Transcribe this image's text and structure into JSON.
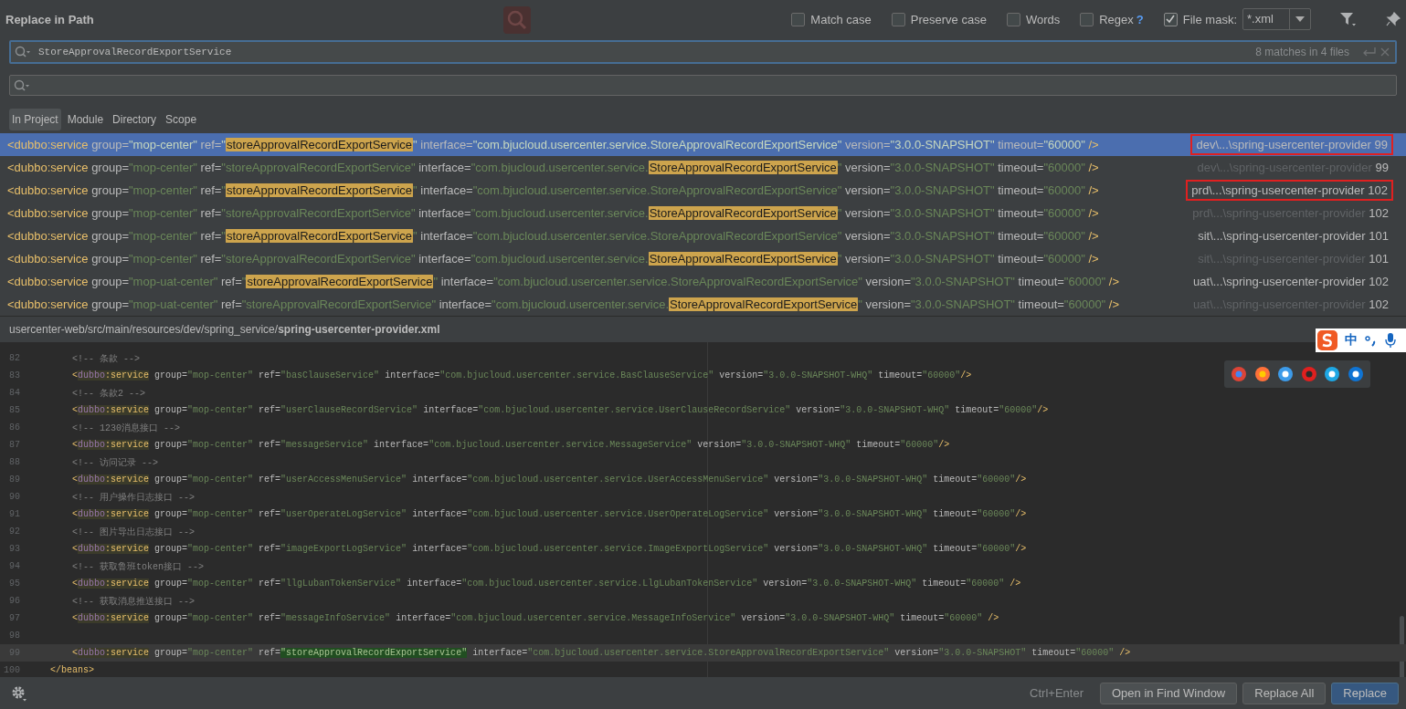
{
  "dialog": {
    "title": "Replace in Path"
  },
  "options": [
    {
      "label": "Match case",
      "checked": false
    },
    {
      "label": "Preserve case",
      "checked": false
    },
    {
      "label": "Words",
      "checked": false
    },
    {
      "label": "Regex",
      "checked": false,
      "help": "?"
    },
    {
      "label": "File mask:",
      "checked": true
    }
  ],
  "file_mask": {
    "value": "*.xml"
  },
  "search": {
    "value": "StoreApprovalRecordExportService",
    "match_count": "8 matches in 4 files"
  },
  "scopes": [
    {
      "label": "In Project",
      "selected": true
    },
    {
      "label": "Module",
      "selected": false
    },
    {
      "label": "Directory",
      "selected": false
    },
    {
      "label": "Scope",
      "selected": false
    }
  ],
  "results": [
    {
      "selected": true,
      "boxed": true,
      "muted_path": false,
      "path": "dev\\...\\spring-usercenter-provider",
      "line": "99",
      "tokens": [
        {
          "kind": "tag",
          "text": "<dubbo:service"
        },
        {
          "kind": "attr",
          "text": " group="
        },
        {
          "kind": "str",
          "text": "\"mop-center\""
        },
        {
          "kind": "attr",
          "text": " ref="
        },
        {
          "kind": "str",
          "text": "\""
        },
        {
          "kind": "match",
          "text": "storeApprovalRecordExportService"
        },
        {
          "kind": "str",
          "text": "\""
        },
        {
          "kind": "attr",
          "text": " interface="
        },
        {
          "kind": "str",
          "text": "\"com.bjucloud.usercenter.service.StoreApprovalRecordExportService\""
        },
        {
          "kind": "attr",
          "text": " version="
        },
        {
          "kind": "str",
          "text": "\"3.0.0-SNAPSHOT\""
        },
        {
          "kind": "attr",
          "text": " timeout="
        },
        {
          "kind": "str",
          "text": "\"60000\""
        },
        {
          "kind": "tag",
          "text": " />"
        }
      ]
    },
    {
      "selected": false,
      "boxed": false,
      "muted_path": true,
      "path": "dev\\...\\spring-usercenter-provider",
      "line": "99",
      "tokens": [
        {
          "kind": "tag",
          "text": "<dubbo:service"
        },
        {
          "kind": "attr",
          "text": " group="
        },
        {
          "kind": "str",
          "text": "\"mop-center\""
        },
        {
          "kind": "attr",
          "text": " ref="
        },
        {
          "kind": "str",
          "text": "\"storeApprovalRecordExportService\""
        },
        {
          "kind": "attr",
          "text": " interface="
        },
        {
          "kind": "str",
          "text": "\"com.bjucloud.usercenter.service."
        },
        {
          "kind": "match",
          "text": "StoreApprovalRecordExportService"
        },
        {
          "kind": "str",
          "text": "\""
        },
        {
          "kind": "attr",
          "text": " version="
        },
        {
          "kind": "str",
          "text": "\"3.0.0-SNAPSHOT\""
        },
        {
          "kind": "attr",
          "text": " timeout="
        },
        {
          "kind": "str",
          "text": "\"60000\""
        },
        {
          "kind": "tag",
          "text": " />"
        }
      ]
    },
    {
      "selected": false,
      "boxed": true,
      "muted_path": false,
      "path": "prd\\...\\spring-usercenter-provider",
      "line": "102",
      "tokens": [
        {
          "kind": "tag",
          "text": "<dubbo:service"
        },
        {
          "kind": "attr",
          "text": " group="
        },
        {
          "kind": "str",
          "text": "\"mop-center\""
        },
        {
          "kind": "attr",
          "text": " ref="
        },
        {
          "kind": "str",
          "text": "\""
        },
        {
          "kind": "match",
          "text": "storeApprovalRecordExportService"
        },
        {
          "kind": "str",
          "text": "\""
        },
        {
          "kind": "attr",
          "text": " interface="
        },
        {
          "kind": "str",
          "text": "\"com.bjucloud.usercenter.service.StoreApprovalRecordExportService\""
        },
        {
          "kind": "attr",
          "text": " version="
        },
        {
          "kind": "str",
          "text": "\"3.0.0-SNAPSHOT\""
        },
        {
          "kind": "attr",
          "text": " timeout="
        },
        {
          "kind": "str",
          "text": "\"60000\""
        },
        {
          "kind": "tag",
          "text": " />"
        }
      ]
    },
    {
      "selected": false,
      "boxed": false,
      "muted_path": true,
      "path": "prd\\...\\spring-usercenter-provider",
      "line": "102",
      "tokens": [
        {
          "kind": "tag",
          "text": "<dubbo:service"
        },
        {
          "kind": "attr",
          "text": " group="
        },
        {
          "kind": "str",
          "text": "\"mop-center\""
        },
        {
          "kind": "attr",
          "text": " ref="
        },
        {
          "kind": "str",
          "text": "\"storeApprovalRecordExportService\""
        },
        {
          "kind": "attr",
          "text": " interface="
        },
        {
          "kind": "str",
          "text": "\"com.bjucloud.usercenter.service."
        },
        {
          "kind": "match",
          "text": "StoreApprovalRecordExportService"
        },
        {
          "kind": "str",
          "text": "\""
        },
        {
          "kind": "attr",
          "text": " version="
        },
        {
          "kind": "str",
          "text": "\"3.0.0-SNAPSHOT\""
        },
        {
          "kind": "attr",
          "text": " timeout="
        },
        {
          "kind": "str",
          "text": "\"60000\""
        },
        {
          "kind": "tag",
          "text": " />"
        }
      ]
    },
    {
      "selected": false,
      "boxed": false,
      "muted_path": false,
      "path": "sit\\...\\spring-usercenter-provider",
      "line": "101",
      "tokens": [
        {
          "kind": "tag",
          "text": "<dubbo:service"
        },
        {
          "kind": "attr",
          "text": " group="
        },
        {
          "kind": "str",
          "text": "\"mop-center\""
        },
        {
          "kind": "attr",
          "text": " ref="
        },
        {
          "kind": "str",
          "text": "\""
        },
        {
          "kind": "match",
          "text": "storeApprovalRecordExportService"
        },
        {
          "kind": "str",
          "text": "\""
        },
        {
          "kind": "attr",
          "text": " interface="
        },
        {
          "kind": "str",
          "text": "\"com.bjucloud.usercenter.service.StoreApprovalRecordExportService\""
        },
        {
          "kind": "attr",
          "text": " version="
        },
        {
          "kind": "str",
          "text": "\"3.0.0-SNAPSHOT\""
        },
        {
          "kind": "attr",
          "text": " timeout="
        },
        {
          "kind": "str",
          "text": "\"60000\""
        },
        {
          "kind": "tag",
          "text": " />"
        }
      ]
    },
    {
      "selected": false,
      "boxed": false,
      "muted_path": true,
      "path": "sit\\...\\spring-usercenter-provider",
      "line": "101",
      "tokens": [
        {
          "kind": "tag",
          "text": "<dubbo:service"
        },
        {
          "kind": "attr",
          "text": " group="
        },
        {
          "kind": "str",
          "text": "\"mop-center\""
        },
        {
          "kind": "attr",
          "text": " ref="
        },
        {
          "kind": "str",
          "text": "\"storeApprovalRecordExportService\""
        },
        {
          "kind": "attr",
          "text": " interface="
        },
        {
          "kind": "str",
          "text": "\"com.bjucloud.usercenter.service."
        },
        {
          "kind": "match",
          "text": "StoreApprovalRecordExportService"
        },
        {
          "kind": "str",
          "text": "\""
        },
        {
          "kind": "attr",
          "text": " version="
        },
        {
          "kind": "str",
          "text": "\"3.0.0-SNAPSHOT\""
        },
        {
          "kind": "attr",
          "text": " timeout="
        },
        {
          "kind": "str",
          "text": "\"60000\""
        },
        {
          "kind": "tag",
          "text": " />"
        }
      ]
    },
    {
      "selected": false,
      "boxed": false,
      "muted_path": false,
      "path": "uat\\...\\spring-usercenter-provider",
      "line": "102",
      "tokens": [
        {
          "kind": "tag",
          "text": "<dubbo:service"
        },
        {
          "kind": "attr",
          "text": " group="
        },
        {
          "kind": "str",
          "text": "\"mop-uat-center\""
        },
        {
          "kind": "attr",
          "text": " ref="
        },
        {
          "kind": "str",
          "text": "\""
        },
        {
          "kind": "match",
          "text": "storeApprovalRecordExportService"
        },
        {
          "kind": "str",
          "text": "\""
        },
        {
          "kind": "attr",
          "text": " interface="
        },
        {
          "kind": "str",
          "text": "\"com.bjucloud.usercenter.service.StoreApprovalRecordExportService\""
        },
        {
          "kind": "attr",
          "text": " version="
        },
        {
          "kind": "str",
          "text": "\"3.0.0-SNAPSHOT\""
        },
        {
          "kind": "attr",
          "text": " timeout="
        },
        {
          "kind": "str",
          "text": "\"60000\""
        },
        {
          "kind": "tag",
          "text": " />"
        }
      ]
    },
    {
      "selected": false,
      "boxed": false,
      "muted_path": true,
      "path": "uat\\...\\spring-usercenter-provider",
      "line": "102",
      "tokens": [
        {
          "kind": "tag",
          "text": "<dubbo:service"
        },
        {
          "kind": "attr",
          "text": " group="
        },
        {
          "kind": "str",
          "text": "\"mop-uat-center\""
        },
        {
          "kind": "attr",
          "text": " ref="
        },
        {
          "kind": "str",
          "text": "\"storeApprovalRecordExportService\""
        },
        {
          "kind": "attr",
          "text": " interface="
        },
        {
          "kind": "str",
          "text": "\"com.bjucloud.usercenter.service."
        },
        {
          "kind": "match",
          "text": "StoreApprovalRecordExportService"
        },
        {
          "kind": "str",
          "text": "\""
        },
        {
          "kind": "attr",
          "text": " version="
        },
        {
          "kind": "str",
          "text": "\"3.0.0-SNAPSHOT\""
        },
        {
          "kind": "attr",
          "text": " timeout="
        },
        {
          "kind": "str",
          "text": "\"60000\""
        },
        {
          "kind": "tag",
          "text": " />"
        }
      ]
    }
  ],
  "preview": {
    "path": "usercenter-web/src/main/resources/dev/spring_service/**spring-usercenter-provider.xml**",
    "lines": [
      {
        "number": "82",
        "current": false,
        "tokens": [
          {
            "kind": "comment",
            "text": "    <!-- 条款 -->"
          }
        ]
      },
      {
        "number": "83",
        "current": false,
        "tokens": [
          {
            "kind": "punct",
            "text": "    <"
          },
          {
            "kind": "ns",
            "text": "dubbo"
          },
          {
            "kind": "name",
            "text": ":service"
          },
          {
            "kind": "attr",
            "text": " group="
          },
          {
            "kind": "str",
            "text": "\"mop-center\""
          },
          {
            "kind": "attr",
            "text": " ref="
          },
          {
            "kind": "str",
            "text": "\"basClauseService\""
          },
          {
            "kind": "attr",
            "text": " interface="
          },
          {
            "kind": "str",
            "text": "\"com.bjucloud.usercenter.service.BasClauseService\""
          },
          {
            "kind": "attr",
            "text": " version="
          },
          {
            "kind": "str",
            "text": "\"3.0.0-SNAPSHOT-WHQ\""
          },
          {
            "kind": "attr",
            "text": " timeout="
          },
          {
            "kind": "str",
            "text": "\"60000\""
          },
          {
            "kind": "punct",
            "text": "/>"
          }
        ]
      },
      {
        "number": "84",
        "current": false,
        "tokens": [
          {
            "kind": "comment",
            "text": "    <!-- 条款2 -->"
          }
        ]
      },
      {
        "number": "85",
        "current": false,
        "tokens": [
          {
            "kind": "punct",
            "text": "    <"
          },
          {
            "kind": "ns",
            "text": "dubbo"
          },
          {
            "kind": "name",
            "text": ":service"
          },
          {
            "kind": "attr",
            "text": " group="
          },
          {
            "kind": "str",
            "text": "\"mop-center\""
          },
          {
            "kind": "attr",
            "text": " ref="
          },
          {
            "kind": "str",
            "text": "\"userClauseRecordService\""
          },
          {
            "kind": "attr",
            "text": " interface="
          },
          {
            "kind": "str",
            "text": "\"com.bjucloud.usercenter.service.UserClauseRecordService\""
          },
          {
            "kind": "attr",
            "text": " version="
          },
          {
            "kind": "str",
            "text": "\"3.0.0-SNAPSHOT-WHQ\""
          },
          {
            "kind": "attr",
            "text": " timeout="
          },
          {
            "kind": "str",
            "text": "\"60000\""
          },
          {
            "kind": "punct",
            "text": "/>"
          }
        ]
      },
      {
        "number": "86",
        "current": false,
        "tokens": [
          {
            "kind": "comment",
            "text": "    <!-- 1230消息接口 -->"
          }
        ]
      },
      {
        "number": "87",
        "current": false,
        "tokens": [
          {
            "kind": "punct",
            "text": "    <"
          },
          {
            "kind": "ns",
            "text": "dubbo"
          },
          {
            "kind": "name",
            "text": ":service"
          },
          {
            "kind": "attr",
            "text": " group="
          },
          {
            "kind": "str",
            "text": "\"mop-center\""
          },
          {
            "kind": "attr",
            "text": " ref="
          },
          {
            "kind": "str",
            "text": "\"messageService\""
          },
          {
            "kind": "attr",
            "text": " interface="
          },
          {
            "kind": "str",
            "text": "\"com.bjucloud.usercenter.service.MessageService\""
          },
          {
            "kind": "attr",
            "text": " version="
          },
          {
            "kind": "str",
            "text": "\"3.0.0-SNAPSHOT-WHQ\""
          },
          {
            "kind": "attr",
            "text": " timeout="
          },
          {
            "kind": "str",
            "text": "\"60000\""
          },
          {
            "kind": "punct",
            "text": "/>"
          }
        ]
      },
      {
        "number": "88",
        "current": false,
        "tokens": [
          {
            "kind": "comment",
            "text": "    <!-- 访问记录 -->"
          }
        ]
      },
      {
        "number": "89",
        "current": false,
        "tokens": [
          {
            "kind": "punct",
            "text": "    <"
          },
          {
            "kind": "ns",
            "text": "dubbo"
          },
          {
            "kind": "name",
            "text": ":service"
          },
          {
            "kind": "attr",
            "text": " group="
          },
          {
            "kind": "str",
            "text": "\"mop-center\""
          },
          {
            "kind": "attr",
            "text": " ref="
          },
          {
            "kind": "str",
            "text": "\"userAccessMenuService\""
          },
          {
            "kind": "attr",
            "text": " interface="
          },
          {
            "kind": "str",
            "text": "\"com.bjucloud.usercenter.service.UserAccessMenuService\""
          },
          {
            "kind": "attr",
            "text": " version="
          },
          {
            "kind": "str",
            "text": "\"3.0.0-SNAPSHOT-WHQ\""
          },
          {
            "kind": "attr",
            "text": " timeout="
          },
          {
            "kind": "str",
            "text": "\"60000\""
          },
          {
            "kind": "punct",
            "text": "/>"
          }
        ]
      },
      {
        "number": "90",
        "current": false,
        "tokens": [
          {
            "kind": "comment",
            "text": "    <!-- 用户操作日志接口 -->"
          }
        ]
      },
      {
        "number": "91",
        "current": false,
        "tokens": [
          {
            "kind": "punct",
            "text": "    <"
          },
          {
            "kind": "ns",
            "text": "dubbo"
          },
          {
            "kind": "name",
            "text": ":service"
          },
          {
            "kind": "attr",
            "text": " group="
          },
          {
            "kind": "str",
            "text": "\"mop-center\""
          },
          {
            "kind": "attr",
            "text": " ref="
          },
          {
            "kind": "str",
            "text": "\"userOperateLogService\""
          },
          {
            "kind": "attr",
            "text": " interface="
          },
          {
            "kind": "str",
            "text": "\"com.bjucloud.usercenter.service.UserOperateLogService\""
          },
          {
            "kind": "attr",
            "text": " version="
          },
          {
            "kind": "str",
            "text": "\"3.0.0-SNAPSHOT-WHQ\""
          },
          {
            "kind": "attr",
            "text": " timeout="
          },
          {
            "kind": "str",
            "text": "\"60000\""
          },
          {
            "kind": "punct",
            "text": "/>"
          }
        ]
      },
      {
        "number": "92",
        "current": false,
        "tokens": [
          {
            "kind": "comment",
            "text": "    <!-- 图片导出日志接口 -->"
          }
        ]
      },
      {
        "number": "93",
        "current": false,
        "tokens": [
          {
            "kind": "punct",
            "text": "    <"
          },
          {
            "kind": "ns",
            "text": "dubbo"
          },
          {
            "kind": "name",
            "text": ":service"
          },
          {
            "kind": "attr",
            "text": " group="
          },
          {
            "kind": "str",
            "text": "\"mop-center\""
          },
          {
            "kind": "attr",
            "text": " ref="
          },
          {
            "kind": "str",
            "text": "\"imageExportLogService\""
          },
          {
            "kind": "attr",
            "text": " interface="
          },
          {
            "kind": "str",
            "text": "\"com.bjucloud.usercenter.service.ImageExportLogService\""
          },
          {
            "kind": "attr",
            "text": " version="
          },
          {
            "kind": "str",
            "text": "\"3.0.0-SNAPSHOT-WHQ\""
          },
          {
            "kind": "attr",
            "text": " timeout="
          },
          {
            "kind": "str",
            "text": "\"60000\""
          },
          {
            "kind": "punct",
            "text": "/>"
          }
        ]
      },
      {
        "number": "94",
        "current": false,
        "tokens": [
          {
            "kind": "comment",
            "text": "    <!-- 获取鲁班token接口 -->"
          }
        ]
      },
      {
        "number": "95",
        "current": false,
        "tokens": [
          {
            "kind": "punct",
            "text": "    <"
          },
          {
            "kind": "ns",
            "text": "dubbo"
          },
          {
            "kind": "name",
            "text": ":service"
          },
          {
            "kind": "attr",
            "text": " group="
          },
          {
            "kind": "str",
            "text": "\"mop-center\""
          },
          {
            "kind": "attr",
            "text": " ref="
          },
          {
            "kind": "str",
            "text": "\"llgLubanTokenService\""
          },
          {
            "kind": "attr",
            "text": " interface="
          },
          {
            "kind": "str",
            "text": "\"com.bjucloud.usercenter.service.LlgLubanTokenService\""
          },
          {
            "kind": "attr",
            "text": " version="
          },
          {
            "kind": "str",
            "text": "\"3.0.0-SNAPSHOT-WHQ\""
          },
          {
            "kind": "attr",
            "text": " timeout="
          },
          {
            "kind": "str",
            "text": "\"60000\""
          },
          {
            "kind": "punct",
            "text": " />"
          }
        ]
      },
      {
        "number": "96",
        "current": false,
        "tokens": [
          {
            "kind": "comment",
            "text": "    <!-- 获取消息推送接口 -->"
          }
        ]
      },
      {
        "number": "97",
        "current": false,
        "tokens": [
          {
            "kind": "punct",
            "text": "    <"
          },
          {
            "kind": "ns",
            "text": "dubbo"
          },
          {
            "kind": "name",
            "text": ":service"
          },
          {
            "kind": "attr",
            "text": " group="
          },
          {
            "kind": "str",
            "text": "\"mop-center\""
          },
          {
            "kind": "attr",
            "text": " ref="
          },
          {
            "kind": "str",
            "text": "\"messageInfoService\""
          },
          {
            "kind": "attr",
            "text": " interface="
          },
          {
            "kind": "str",
            "text": "\"com.bjucloud.usercenter.service.MessageInfoService\""
          },
          {
            "kind": "attr",
            "text": " version="
          },
          {
            "kind": "str",
            "text": "\"3.0.0-SNAPSHOT-WHQ\""
          },
          {
            "kind": "attr",
            "text": " timeout="
          },
          {
            "kind": "str",
            "text": "\"60000\""
          },
          {
            "kind": "punct",
            "text": " />"
          }
        ]
      },
      {
        "number": "98",
        "current": false
      },
      {
        "number": "99",
        "current": true,
        "tokens": [
          {
            "kind": "punct",
            "text": "    <"
          },
          {
            "kind": "ns",
            "text": "dubbo"
          },
          {
            "kind": "name",
            "text": ":service"
          },
          {
            "kind": "attr",
            "text": " group="
          },
          {
            "kind": "str",
            "text": "\"mop-center\""
          },
          {
            "kind": "attr",
            "text": " ref="
          },
          {
            "kind": "found",
            "text": "\"storeApprovalRecordExportService\""
          },
          {
            "kind": "attr",
            "text": " interface="
          },
          {
            "kind": "str",
            "text": "\"com.bjucloud.usercenter.service.StoreApprovalRecordExportService\""
          },
          {
            "kind": "attr",
            "text": " version="
          },
          {
            "kind": "str",
            "text": "\"3.0.0-SNAPSHOT\""
          },
          {
            "kind": "attr",
            "text": " timeout="
          },
          {
            "kind": "str",
            "text": "\"60000\""
          },
          {
            "kind": "punct",
            "text": " />"
          }
        ]
      },
      {
        "number": "100",
        "current": false,
        "tokens": [
          {
            "kind": "punct",
            "text": "</"
          },
          {
            "kind": "tag",
            "text": "beans"
          },
          {
            "kind": "punct",
            "text": ">"
          }
        ]
      }
    ]
  },
  "ime": {
    "mode": "中"
  },
  "footer": {
    "shortcut": "Ctrl+Enter",
    "buttons": [
      {
        "label": "Open in Find Window",
        "default": false
      },
      {
        "label": "Replace All",
        "default": false
      },
      {
        "label": "Replace",
        "default": true
      }
    ]
  }
}
